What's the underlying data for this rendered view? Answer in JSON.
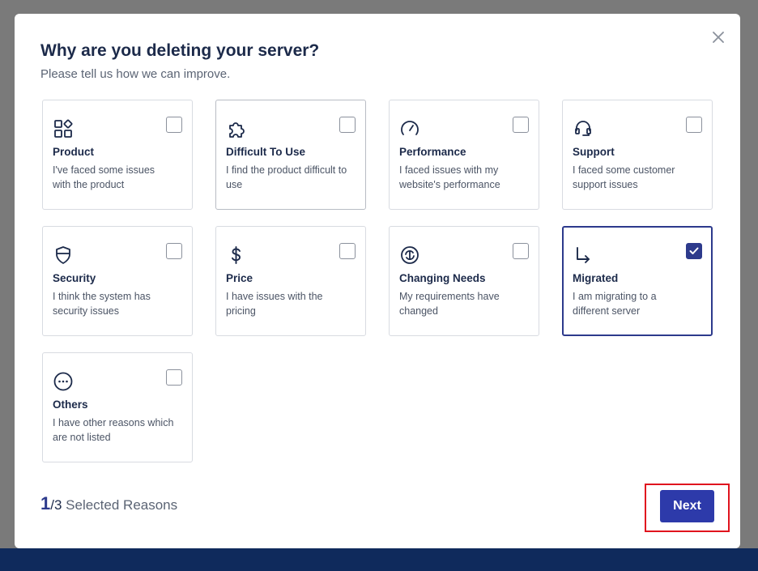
{
  "modal": {
    "title": "Why are you deleting your server?",
    "subtitle": "Please tell us how we can improve."
  },
  "reasons": [
    {
      "label": "Product",
      "desc": "I've faced some issues with the product",
      "icon": "product-icon",
      "checked": false
    },
    {
      "label": "Difficult To Use",
      "desc": "I find the product difficult to use",
      "icon": "puzzle-icon",
      "checked": false
    },
    {
      "label": "Performance",
      "desc": "I faced issues with my website's performance",
      "icon": "speedometer-icon",
      "checked": false
    },
    {
      "label": "Support",
      "desc": "I faced some customer support issues",
      "icon": "headset-icon",
      "checked": false
    },
    {
      "label": "Security",
      "desc": "I think the system has security issues",
      "icon": "shield-icon",
      "checked": false
    },
    {
      "label": "Price",
      "desc": "I have issues with the pricing",
      "icon": "dollar-icon",
      "checked": false
    },
    {
      "label": "Changing Needs",
      "desc": "My requirements have changed",
      "icon": "cycle-dollar-icon",
      "checked": false
    },
    {
      "label": "Migrated",
      "desc": "I am migrating to a different server",
      "icon": "arrow-turn-icon",
      "checked": true
    },
    {
      "label": "Others",
      "desc": "I have other reasons which are not listed",
      "icon": "more-icon",
      "checked": false
    }
  ],
  "footer": {
    "selected": "1",
    "max": "/3",
    "selected_text": " Selected Reasons",
    "next_label": "Next"
  },
  "colors": {
    "accent": "#2d3a8c",
    "button": "#2d3aaa",
    "highlight": "#e0141e",
    "text": "#1c2a4a"
  }
}
